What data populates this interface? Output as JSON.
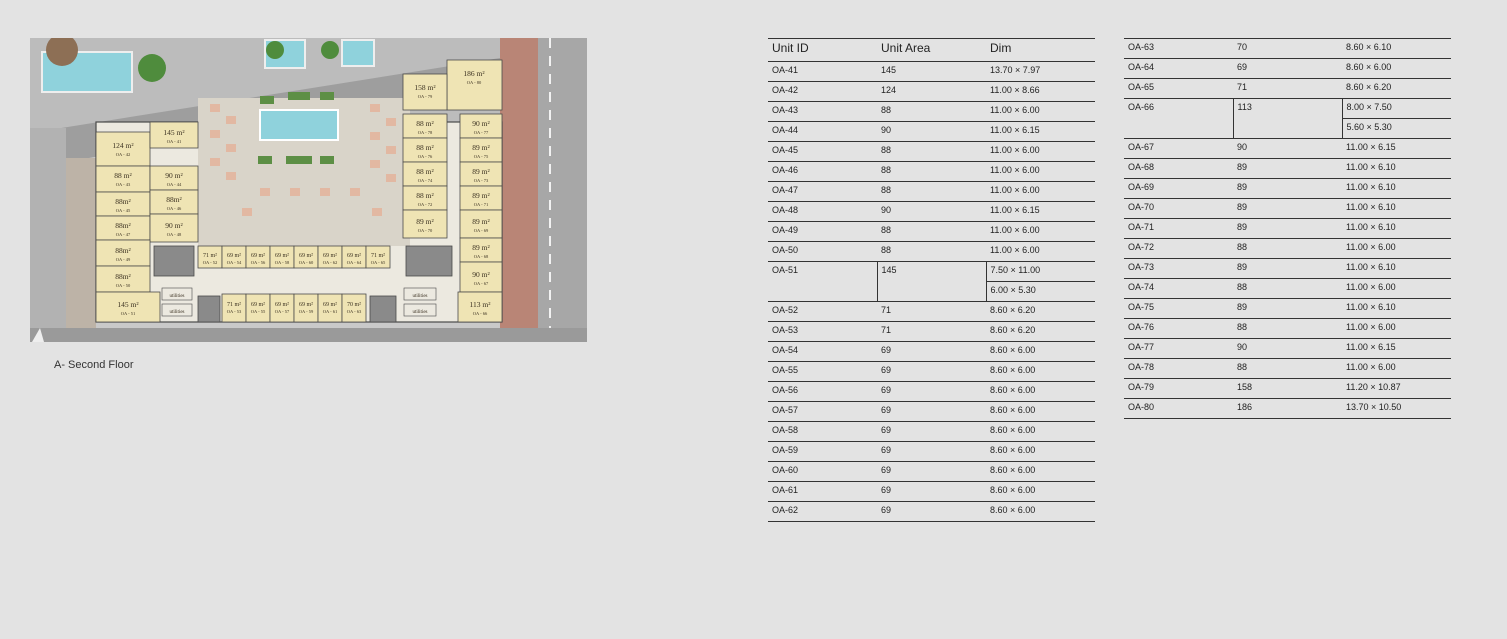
{
  "caption": "A- Second Floor",
  "headers": {
    "unit_id": "Unit ID",
    "unit_area": "Unit Area",
    "dim": "Dim"
  },
  "plan_labels": [
    {
      "area": "186 m²",
      "id": "OA - 80"
    },
    {
      "area": "158 m²",
      "id": "OA - 79"
    },
    {
      "area": "88 m²",
      "id": "OA - 78"
    },
    {
      "area": "90 m²",
      "id": "OA - 77"
    },
    {
      "area": "88 m²",
      "id": "OA - 76"
    },
    {
      "area": "89 m²",
      "id": "OA - 75"
    },
    {
      "area": "88 m²",
      "id": "OA - 74"
    },
    {
      "area": "89 m²",
      "id": "OA - 73"
    },
    {
      "area": "88 m²",
      "id": "OA - 72"
    },
    {
      "area": "89 m²",
      "id": "OA - 71"
    },
    {
      "area": "89 m²",
      "id": "OA - 70"
    },
    {
      "area": "89 m²",
      "id": "OA - 69"
    },
    {
      "area": "89 m²",
      "id": "OA - 68"
    },
    {
      "area": "90 m²",
      "id": "OA - 67"
    },
    {
      "area": "113 m²",
      "id": "OA - 66"
    },
    {
      "area": "124 m²",
      "id": "OA - 42"
    },
    {
      "area": "145 m²",
      "id": "OA - 41"
    },
    {
      "area": "88 m²",
      "id": "OA - 43"
    },
    {
      "area": "90 m²",
      "id": "OA - 44"
    },
    {
      "area": "88m²",
      "id": "OA - 45"
    },
    {
      "area": "88m²",
      "id": "OA - 46"
    },
    {
      "area": "88m²",
      "id": "OA - 47"
    },
    {
      "area": "90 m²",
      "id": "OA - 48"
    },
    {
      "area": "88m²",
      "id": "OA - 49"
    },
    {
      "area": "88m²",
      "id": "OA - 50"
    },
    {
      "area": "145 m²",
      "id": "OA - 51"
    },
    {
      "area": "71 m²",
      "id": "OA - 52"
    },
    {
      "area": "69 m²",
      "id": "OA - 54"
    },
    {
      "area": "69 m²",
      "id": "OA - 56"
    },
    {
      "area": "69 m²",
      "id": "OA - 58"
    },
    {
      "area": "69 m²",
      "id": "OA - 60"
    },
    {
      "area": "69 m²",
      "id": "OA - 62"
    },
    {
      "area": "69 m²",
      "id": "OA - 64"
    },
    {
      "area": "71 m²",
      "id": "OA - 65"
    },
    {
      "area": "71 m²",
      "id": "OA - 53"
    },
    {
      "area": "69 m²",
      "id": "OA - 55"
    },
    {
      "area": "69 m²",
      "id": "OA - 57"
    },
    {
      "area": "69 m²",
      "id": "OA - 59"
    },
    {
      "area": "69 m²",
      "id": "OA - 61"
    },
    {
      "area": "70 m²",
      "id": "OA - 63"
    }
  ],
  "plan_utility_labels": [
    "utilities",
    "utilities",
    "utilities",
    "utilities"
  ],
  "left_rows": [
    {
      "id": "OA-41",
      "area": "145",
      "dim": "13.70 × 7.97"
    },
    {
      "id": "OA-42",
      "area": "124",
      "dim": "11.00 × 8.66"
    },
    {
      "id": "OA-43",
      "area": "88",
      "dim": "11.00 × 6.00"
    },
    {
      "id": "OA-44",
      "area": "90",
      "dim": "11.00 × 6.15"
    },
    {
      "id": "OA-45",
      "area": "88",
      "dim": "11.00 × 6.00"
    },
    {
      "id": "OA-46",
      "area": "88",
      "dim": "11.00 × 6.00"
    },
    {
      "id": "OA-47",
      "area": "88",
      "dim": "11.00 × 6.00"
    },
    {
      "id": "OA-48",
      "area": "90",
      "dim": "11.00 × 6.15"
    },
    {
      "id": "OA-49",
      "area": "88",
      "dim": "11.00 × 6.00"
    },
    {
      "id": "OA-50",
      "area": "88",
      "dim": "11.00 × 6.00"
    },
    {
      "id": "OA-51",
      "area": "145",
      "dim": "7.50 × 11.00",
      "dim2": "6.00 × 5.30"
    },
    {
      "id": "OA-52",
      "area": "71",
      "dim": "8.60 × 6.20"
    },
    {
      "id": "OA-53",
      "area": "71",
      "dim": "8.60 × 6.20"
    },
    {
      "id": "OA-54",
      "area": "69",
      "dim": "8.60 × 6.00"
    },
    {
      "id": "OA-55",
      "area": "69",
      "dim": "8.60 × 6.00"
    },
    {
      "id": "OA-56",
      "area": "69",
      "dim": "8.60 × 6.00"
    },
    {
      "id": "OA-57",
      "area": "69",
      "dim": "8.60 × 6.00"
    },
    {
      "id": "OA-58",
      "area": "69",
      "dim": "8.60 × 6.00"
    },
    {
      "id": "OA-59",
      "area": "69",
      "dim": "8.60 × 6.00"
    },
    {
      "id": "OA-60",
      "area": "69",
      "dim": "8.60 × 6.00"
    },
    {
      "id": "OA-61",
      "area": "69",
      "dim": "8.60 × 6.00"
    },
    {
      "id": "OA-62",
      "area": "69",
      "dim": "8.60 × 6.00"
    }
  ],
  "right_rows": [
    {
      "id": "OA-63",
      "area": "70",
      "dim": "8.60 × 6.10"
    },
    {
      "id": "OA-64",
      "area": "69",
      "dim": "8.60 × 6.00"
    },
    {
      "id": "OA-65",
      "area": "71",
      "dim": "8.60 × 6.20"
    },
    {
      "id": "OA-66",
      "area": "113",
      "dim": "8.00 × 7.50",
      "dim2": "5.60 × 5.30"
    },
    {
      "id": "OA-67",
      "area": "90",
      "dim": "11.00 × 6.15"
    },
    {
      "id": "OA-68",
      "area": "89",
      "dim": "11.00 × 6.10"
    },
    {
      "id": "OA-69",
      "area": "89",
      "dim": "11.00 × 6.10"
    },
    {
      "id": "OA-70",
      "area": "89",
      "dim": "11.00 × 6.10"
    },
    {
      "id": "OA-71",
      "area": "89",
      "dim": "11.00 × 6.10"
    },
    {
      "id": "OA-72",
      "area": "88",
      "dim": "11.00 × 6.00"
    },
    {
      "id": "OA-73",
      "area": "89",
      "dim": "11.00 × 6.10"
    },
    {
      "id": "OA-74",
      "area": "88",
      "dim": "11.00 × 6.00"
    },
    {
      "id": "OA-75",
      "area": "89",
      "dim": "11.00 × 6.10"
    },
    {
      "id": "OA-76",
      "area": "88",
      "dim": "11.00 × 6.00"
    },
    {
      "id": "OA-77",
      "area": "90",
      "dim": "11.00 × 6.15"
    },
    {
      "id": "OA-78",
      "area": "88",
      "dim": "11.00 × 6.00"
    },
    {
      "id": "OA-79",
      "area": "158",
      "dim": "11.20 × 10.87"
    },
    {
      "id": "OA-80",
      "area": "186",
      "dim": "13.70 × 10.50"
    }
  ],
  "colors": {
    "unit_fill": "#efe4b4",
    "corridor": "#ece9e0",
    "wall": "#4a4a4a",
    "road": "#a7a7a7",
    "brick": "#b98576",
    "pool": "#8fd2dc",
    "green": "#5d8f45",
    "shadow": "#b2b2b2"
  }
}
